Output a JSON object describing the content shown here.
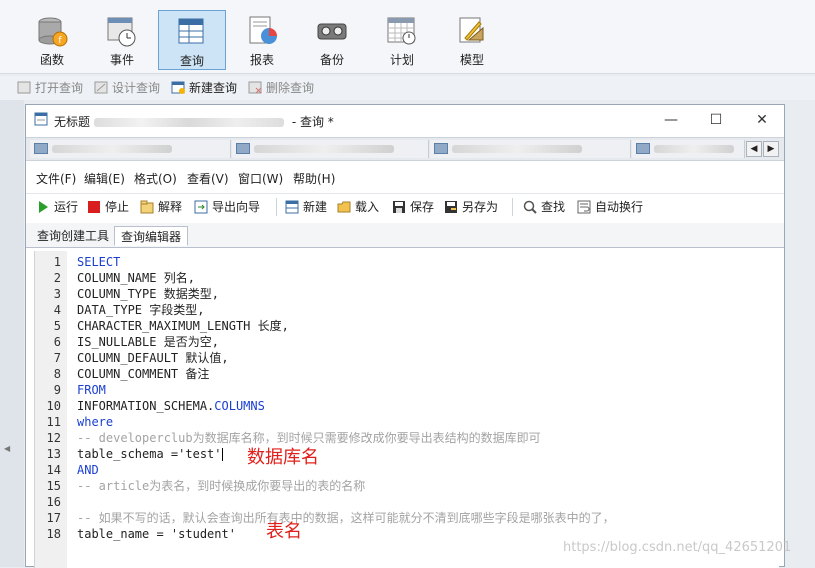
{
  "main_toolbar": {
    "items": [
      {
        "label": "函数",
        "icon": "database-function-icon"
      },
      {
        "label": "事件",
        "icon": "event-clock-icon"
      },
      {
        "label": "查询",
        "icon": "query-table-icon",
        "active": true
      },
      {
        "label": "报表",
        "icon": "report-chart-icon"
      },
      {
        "label": "备份",
        "icon": "backup-tape-icon"
      },
      {
        "label": "计划",
        "icon": "schedule-calendar-icon"
      },
      {
        "label": "模型",
        "icon": "model-diagram-icon"
      }
    ]
  },
  "sub_toolbar": {
    "open_query": "打开查询",
    "design_query": "设计查询",
    "new_query": "新建查询",
    "delete_query": "删除查询"
  },
  "query_window": {
    "title_prefix": "无标题",
    "title_suffix": " - 查询 *",
    "minimize": "—",
    "maximize": "☐",
    "close": "✕",
    "menu": [
      "文件(F)",
      "编辑(E)",
      "格式(O)",
      "查看(V)",
      "窗口(W)",
      "帮助(H)"
    ],
    "actions": {
      "run": "运行",
      "stop": "停止",
      "explain": "解释",
      "export_wizard": "导出向导",
      "new": "新建",
      "load": "载入",
      "save": "保存",
      "save_as": "另存为",
      "find": "查找",
      "word_wrap": "自动换行"
    },
    "editor_tabs": [
      "查询创建工具",
      "查询编辑器"
    ]
  },
  "sql_lines": [
    {
      "n": "1",
      "text": "SELECT",
      "kind": "kw"
    },
    {
      "n": "2",
      "text": "COLUMN_NAME 列名,",
      "kind": "tx"
    },
    {
      "n": "3",
      "text": "COLUMN_TYPE 数据类型,",
      "kind": "tx"
    },
    {
      "n": "4",
      "text": "DATA_TYPE 字段类型,",
      "kind": "tx"
    },
    {
      "n": "5",
      "text": "CHARACTER_MAXIMUM_LENGTH 长度,",
      "kind": "tx"
    },
    {
      "n": "6",
      "text": "IS_NULLABLE 是否为空,",
      "kind": "tx"
    },
    {
      "n": "7",
      "text": "COLUMN_DEFAULT 默认值,",
      "kind": "tx"
    },
    {
      "n": "8",
      "text": "COLUMN_COMMENT 备注",
      "kind": "tx"
    },
    {
      "n": "9",
      "text": "FROM",
      "kind": "kw"
    },
    {
      "n": "10",
      "text": "INFORMATION_SCHEMA.",
      "kind": "tx",
      "tail": "COLUMNS"
    },
    {
      "n": "11",
      "text": "where",
      "kind": "kw"
    },
    {
      "n": "12",
      "text": "-- developerclub为数据库名称，到时候只需要修改成你要导出表结构的数据库即可",
      "kind": "cm"
    },
    {
      "n": "13",
      "text": "table_schema ='test'",
      "kind": "tx"
    },
    {
      "n": "14",
      "text": "AND",
      "kind": "kw"
    },
    {
      "n": "15",
      "text": "-- article为表名，到时候换成你要导出的表的名称",
      "kind": "cm"
    },
    {
      "n": "16",
      "text": "",
      "kind": "tx"
    },
    {
      "n": "17",
      "text": "-- 如果不写的话，默认会查询出所有表中的数据，这样可能就分不清到底哪些字段是哪张表中的了，",
      "kind": "cm"
    },
    {
      "n": "18",
      "text": "table_name = 'student'",
      "kind": "tx"
    }
  ],
  "annotations": {
    "schema_note": "数据库名",
    "table_note": "表名"
  },
  "watermark": "https://blog.csdn.net/qq_42651201",
  "colors": {
    "keyword": "#1a3fd0",
    "comment": "#a3a3a3",
    "annotation": "#e0201b",
    "active_tab": "#cde4f7"
  }
}
